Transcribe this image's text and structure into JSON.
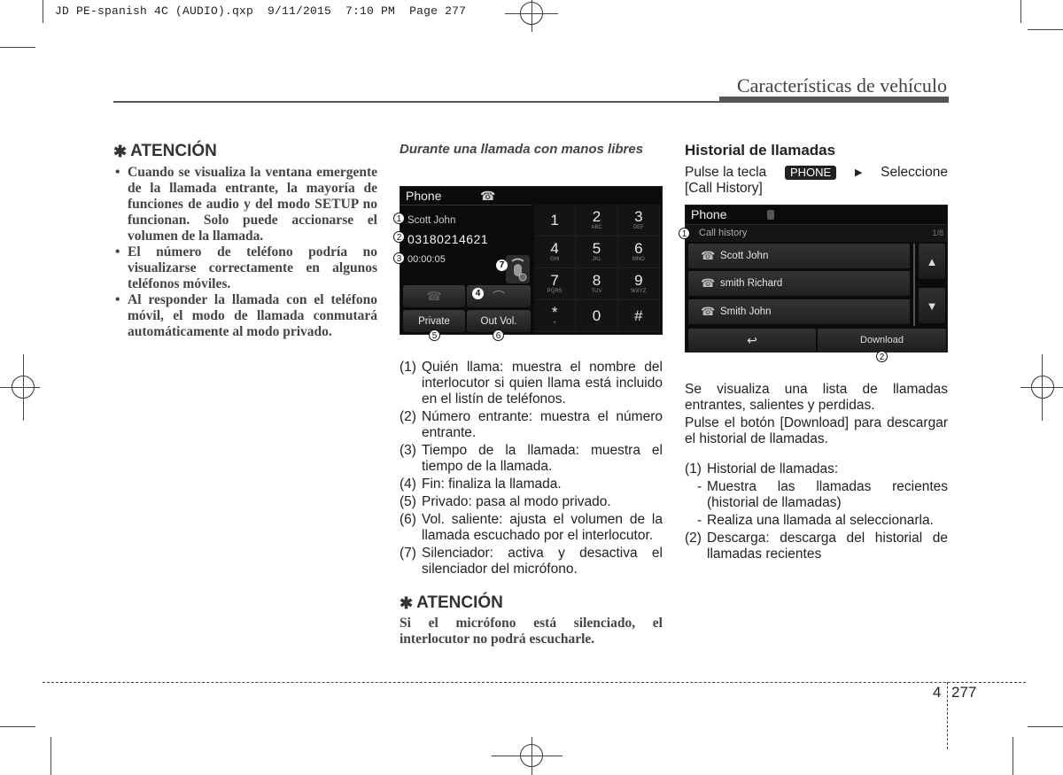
{
  "print_slug": {
    "text": "JD PE-spanish 4C (AUDIO).qxp  9/11/2015  7:10 PM  Page 277"
  },
  "header": {
    "section_title": "Características de vehículo"
  },
  "left_column": {
    "attention": {
      "icon": "asterisk-icon",
      "title": "ATENCIÓN",
      "bullets": [
        "Cuando se visualiza la ventana emergente de la llamada entrante, la mayoría de funciones de audio y del modo SETUP no funcionan. Solo puede accionarse el volumen de la llamada.",
        "El número de teléfono podría no visualizarse correctamente en algunos teléfonos móviles.",
        "Al responder la llamada con el teléfono móvil, el modo de llamada conmutará automáticamente al modo privado."
      ]
    }
  },
  "middle_column": {
    "subheading": "Durante una llamada con manos libres",
    "screen": {
      "title": "Phone",
      "caller_name": "Scott John",
      "caller_number": "03180214621",
      "call_time": "00:00:05",
      "buttons": {
        "private": "Private",
        "out_vol": "Out Vol."
      },
      "keypad": [
        {
          "digit": "1",
          "letters": ""
        },
        {
          "digit": "2",
          "letters": "ABC"
        },
        {
          "digit": "3",
          "letters": "DEF"
        },
        {
          "digit": "4",
          "letters": "GHI"
        },
        {
          "digit": "5",
          "letters": "JKL"
        },
        {
          "digit": "6",
          "letters": "MNO"
        },
        {
          "digit": "7",
          "letters": "PQRS"
        },
        {
          "digit": "8",
          "letters": "TUV"
        },
        {
          "digit": "9",
          "letters": "WXYZ"
        },
        {
          "digit": "*",
          "letters": "+"
        },
        {
          "digit": "0",
          "letters": ""
        },
        {
          "digit": "#",
          "letters": ""
        }
      ],
      "callouts": [
        "1",
        "2",
        "3",
        "4",
        "5",
        "6",
        "7"
      ]
    },
    "items": [
      {
        "num": "(1)",
        "text": "Quién llama: muestra el nombre del interlocutor si quien llama está incluido en el listín de teléfonos."
      },
      {
        "num": "(2)",
        "text": "Número entrante: muestra el número entrante."
      },
      {
        "num": "(3)",
        "text": "Tiempo de la llamada: muestra el tiempo de la llamada."
      },
      {
        "num": "(4)",
        "text": "Fin: finaliza la llamada."
      },
      {
        "num": "(5)",
        "text": "Privado: pasa al modo privado."
      },
      {
        "num": "(6)",
        "text": "Vol. saliente: ajusta el volumen de la llamada escuchado por el interlocutor."
      },
      {
        "num": "(7)",
        "text": "Silenciador: activa y desactiva el silenciador del micrófono."
      }
    ],
    "attention": {
      "icon": "asterisk-icon",
      "title": "ATENCIÓN",
      "body": "Si el micrófono está silenciado, el interlocutor no podrá escucharle."
    }
  },
  "right_column": {
    "heading": "Historial de llamadas",
    "instruction_before": "Pulse la tecla",
    "phone_key": "PHONE",
    "instruction_after": "Seleccione",
    "instruction_line2": "[Call History]",
    "screen": {
      "title": "Phone",
      "subtitle": "Call history",
      "page_indicator": "1/8",
      "entries": [
        {
          "name": "Scott John",
          "type": "outgoing"
        },
        {
          "name": "smith Richard",
          "type": "outgoing"
        },
        {
          "name": "Smith John",
          "type": "missed"
        }
      ],
      "back_icon": "back-arrow-icon",
      "download_label": "Download",
      "callouts": [
        "1",
        "2"
      ]
    },
    "para1": "Se visualiza una lista de llamadas entrantes, salientes y perdidas.",
    "para2": "Pulse el botón [Download] para descargar el historial de llamadas.",
    "items": [
      {
        "num": "(1)",
        "text": "Historial de llamadas:",
        "sub": [
          "Muestra las llamadas recientes (historial de llamadas)",
          "Realiza una llamada al seleccionarla."
        ]
      },
      {
        "num": "(2)",
        "text": "Descarga: descarga del historial de llamadas recientes",
        "sub": []
      }
    ]
  },
  "footer": {
    "chapter": "4",
    "page": "277"
  }
}
